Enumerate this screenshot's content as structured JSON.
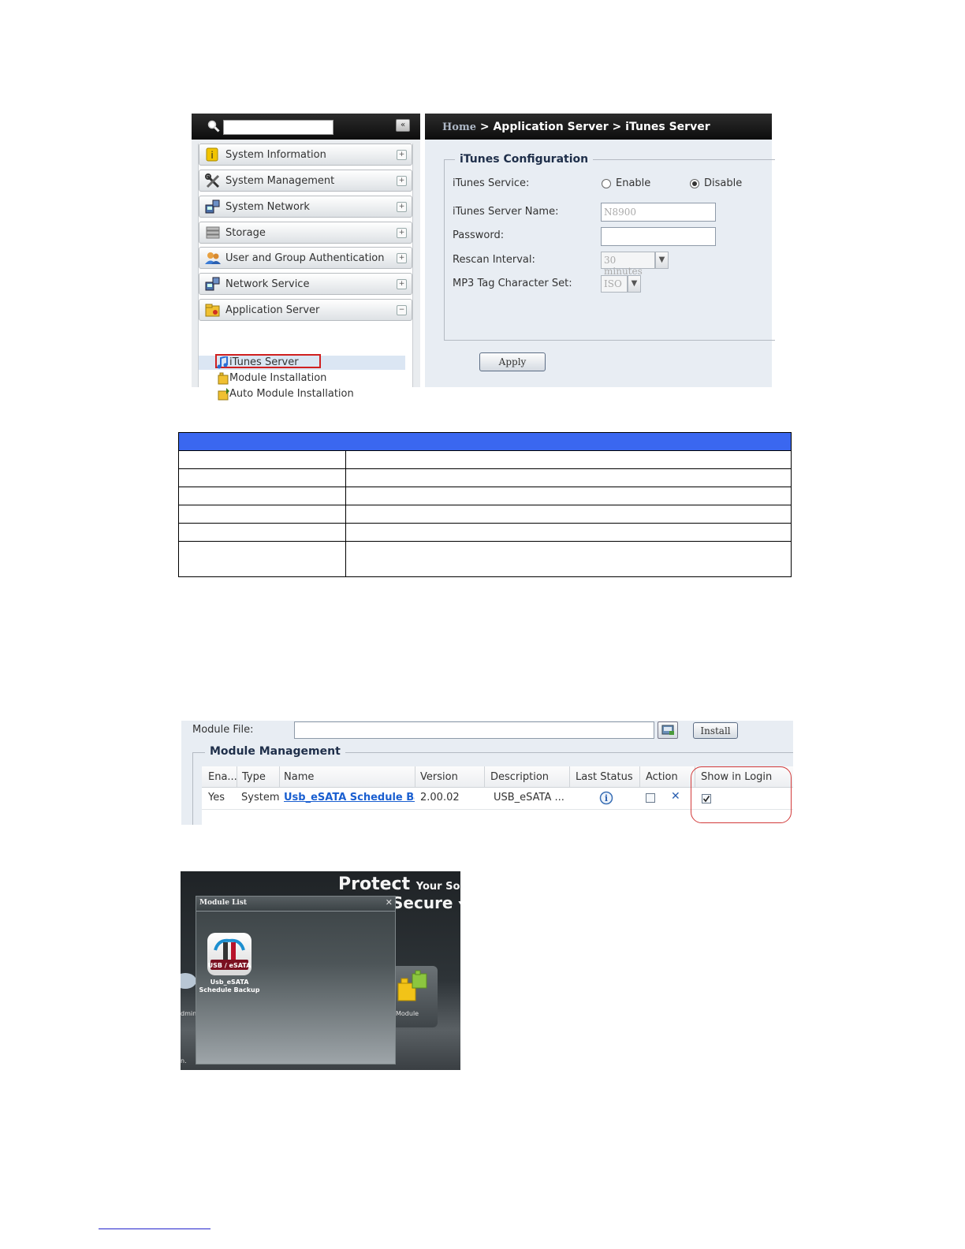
{
  "itunes_ui": {
    "search": {
      "placeholder": ""
    },
    "collapse_label": "«",
    "menu": [
      {
        "label": "System Information",
        "icon": "info-icon",
        "toggle": "+"
      },
      {
        "label": "System Management",
        "icon": "tools-icon",
        "toggle": "+"
      },
      {
        "label": "System Network",
        "icon": "network-icon",
        "toggle": "+"
      },
      {
        "label": "Storage",
        "icon": "storage-icon",
        "toggle": "+"
      },
      {
        "label": "User and Group Authentication",
        "icon": "users-icon",
        "toggle": "+"
      },
      {
        "label": "Network Service",
        "icon": "network-service-icon",
        "toggle": "+"
      },
      {
        "label": "Application Server",
        "icon": "application-server-icon",
        "toggle": "−"
      }
    ],
    "submenu": [
      {
        "label": "iTunes Server",
        "icon": "music-note-icon"
      },
      {
        "label": "Module Installation",
        "icon": "module-icon"
      },
      {
        "label": "Auto Module Installation",
        "icon": "auto-module-icon"
      }
    ],
    "breadcrumb": {
      "home": "Home",
      "sep": ">",
      "section": "Application Server",
      "page": "iTunes Server"
    },
    "config": {
      "legend": "iTunes Configuration",
      "service_label": "iTunes Service:",
      "enable_label": "Enable",
      "disable_label": "Disable",
      "server_name_label": "iTunes Server Name:",
      "server_name_value": "N8900",
      "password_label": "Password:",
      "password_value": "",
      "rescan_label": "Rescan Interval:",
      "rescan_value": "30 minutes",
      "mp3_label": "MP3 Tag Character Set:",
      "mp3_value": "ISO",
      "apply_label": "Apply"
    }
  },
  "module_ui": {
    "module_file_label": "Module File:",
    "install_label": "Install",
    "legend": "Module Management",
    "columns": [
      "Ena...",
      "Type",
      "Name",
      "Version",
      "Description",
      "Last Status",
      "Action",
      "Show in Login"
    ],
    "row": {
      "enabled": "Yes",
      "type": "System",
      "name": "Usb_eSATA Schedule Ba",
      "version": "2.00.02",
      "description": "USB_eSATA ..."
    }
  },
  "login_ui": {
    "banner1_big": "Protect",
    "banner1_small": "Your Sourc",
    "banner2_big": "Secure",
    "banner2_small": "Yo",
    "dialog_title": "Module List",
    "app_badge": "USB / eSATA",
    "app_label_1": "Usb_eSATA",
    "app_label_2": "Schedule Backup",
    "side_label": "Module",
    "admin_label": "dmin",
    "bottom_frag": "n."
  }
}
